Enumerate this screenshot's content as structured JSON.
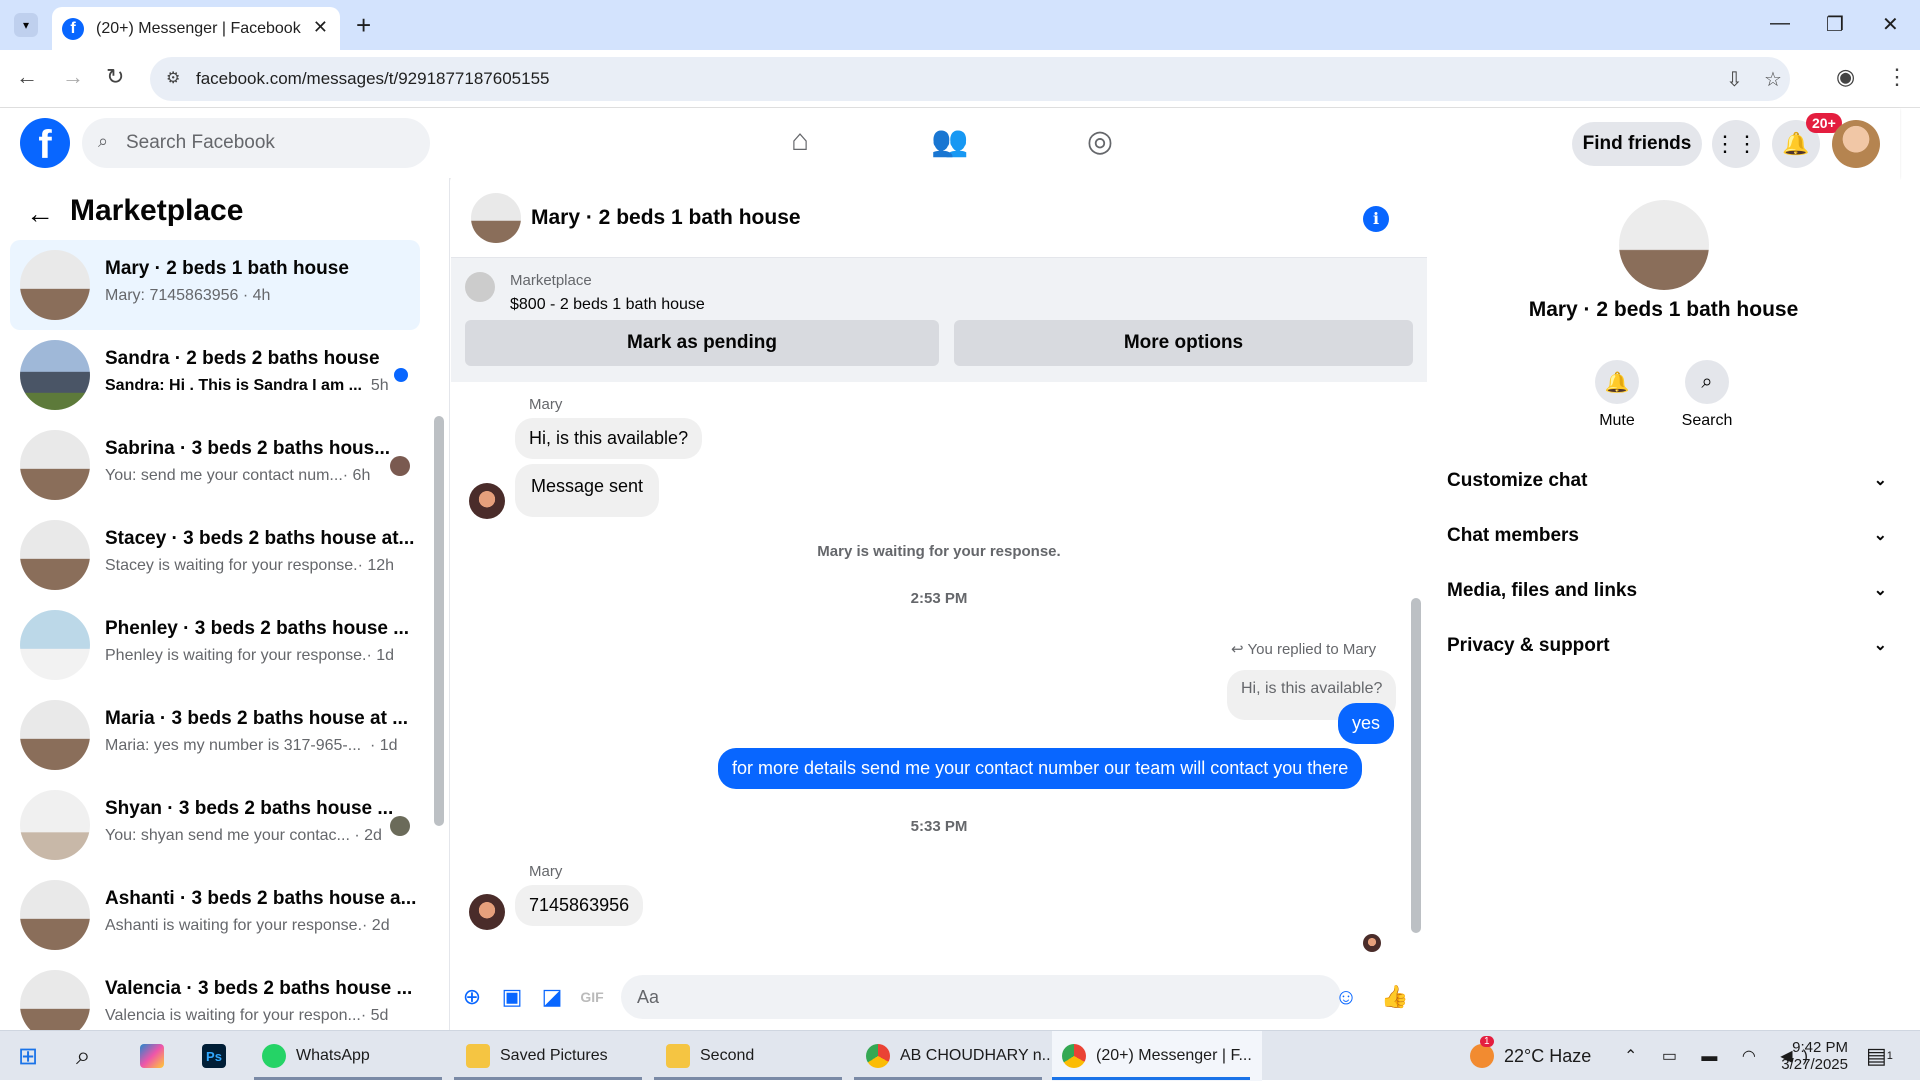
{
  "browser": {
    "tab_title": "(20+) Messenger | Facebook",
    "url": "facebook.com/messages/t/9291877187605155"
  },
  "fb": {
    "search_placeholder": "Search Facebook",
    "find_friends": "Find friends",
    "notif_badge": "20+"
  },
  "sidebar": {
    "title": "Marketplace",
    "conversations": [
      {
        "name": "Mary · 2 beds 1 bath house",
        "sub": "Mary: 7145863956 · 4h",
        "active": true
      },
      {
        "name": "Sandra · 2 beds 2 baths house",
        "sub": "Sandra: Hi . This is Sandra I am ...",
        "time": "5h",
        "unread": true
      },
      {
        "name": "Sabrina · 3 beds 2 baths hous...",
        "sub": "You: send me your contact num...",
        "time": "· 6h"
      },
      {
        "name": "Stacey · 3 beds 2 baths house at...",
        "sub": "Stacey is waiting for your response.",
        "time": "· 12h"
      },
      {
        "name": "Phenley · 3 beds 2 baths house ...",
        "sub": "Phenley is waiting for your response.",
        "time": "· 1d"
      },
      {
        "name": "Maria · 3 beds 2 baths house at ...",
        "sub": "Maria: yes my number is 317-965-...",
        "time": "· 1d"
      },
      {
        "name": "Shyan · 3 beds 2 baths house ...",
        "sub": "You: shyan send me your contac...",
        "time": "· 2d"
      },
      {
        "name": "Ashanti · 3 beds 2 baths house a...",
        "sub": "Ashanti is waiting for your response.",
        "time": "· 2d"
      },
      {
        "name": "Valencia · 3 beds 2 baths house ...",
        "sub": "Valencia is waiting for your respon...",
        "time": "· 5d"
      }
    ]
  },
  "chat": {
    "title": "Mary · 2 beds 1 bath house",
    "marketplace_label": "Marketplace",
    "listing": "$800 - 2 beds 1 bath house",
    "mark_pending": "Mark as pending",
    "more_options": "More options",
    "sender1": "Mary",
    "msg1": "Hi, is this available?",
    "msg2": "Message sent",
    "waiting": "Mary is waiting for your response.",
    "time1": "2:53 PM",
    "replied": "You replied to Mary",
    "quoted": "Hi, is this available?",
    "out1": "yes",
    "out2": "for more details send me your contact number our team will contact you there",
    "time2": "5:33 PM",
    "sender2": "Mary",
    "msg3": "7145863956",
    "composer_placeholder": "Aa"
  },
  "details": {
    "name": "Mary · 2 beds 1 bath house",
    "mute": "Mute",
    "search": "Search",
    "sections": [
      "Customize chat",
      "Chat members",
      "Media, files and links",
      "Privacy & support"
    ]
  },
  "taskbar": {
    "apps": [
      "WhatsApp",
      "Saved Pictures",
      "Second",
      "AB CHOUDHARY n...",
      "(20+) Messenger | F..."
    ],
    "weather": "22°C  Haze",
    "time": "9:42 PM",
    "date": "3/27/2025",
    "weather_badge": "1",
    "notif_count": "1"
  }
}
